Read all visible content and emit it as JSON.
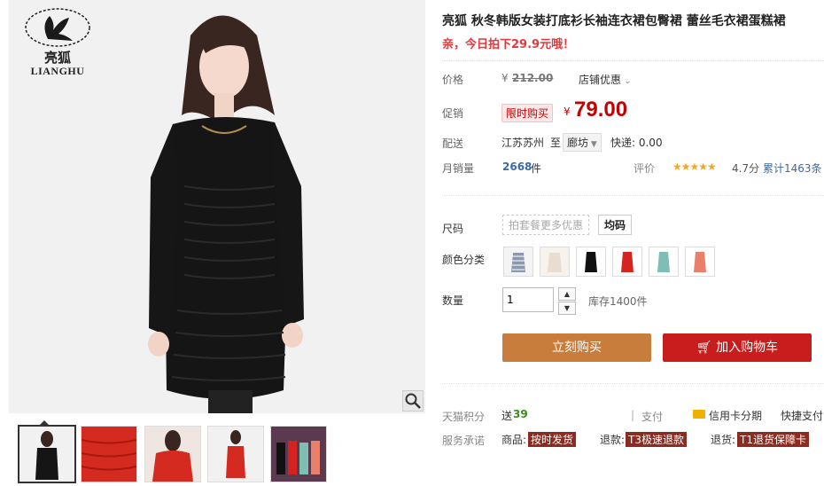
{
  "brand": {
    "logo_cn": "亮狐",
    "logo_en": "LIANGHU"
  },
  "product": {
    "title": "亮狐 秋冬韩版女装打底衫长袖连衣裙包臀裙 蕾丝毛衣裙蛋糕裙",
    "promo": "亲，今日拍下29.9元哦！"
  },
  "price": {
    "label": "价格",
    "currency": "¥",
    "original": "212.00",
    "discount_dropdown": "店铺优惠",
    "promo_label": "促销",
    "promo_tag": "限时购买",
    "promo_currency": "¥",
    "promo_price": "79.00"
  },
  "shipping": {
    "label": "配送",
    "from": "江苏苏州",
    "to_word": "至",
    "to_city": "廊坊",
    "express": "快递: 0.00"
  },
  "sales": {
    "label": "月销量",
    "count": "2668",
    "unit": "件",
    "rating_label": "评价",
    "stars": "★★★★★",
    "score": "4.7分",
    "reviews": "累计1463条"
  },
  "options": {
    "size_label": "尺码",
    "size_hint": "拍套餐更多优惠",
    "size_value": "均码",
    "color_label": "颜色分类",
    "colors": [
      "#f0f0f0",
      "#efe8e0",
      "#111111",
      "#d7231f",
      "#7dbfb4",
      "#e8806c"
    ]
  },
  "quantity": {
    "label": "数量",
    "value": "1",
    "stock": "库存1400件"
  },
  "buttons": {
    "buy": "立刻购买",
    "cart": "加入购物车"
  },
  "footer": {
    "points_label": "天猫积分",
    "points_prefix": "送",
    "points_value": "39",
    "pay_label": "支付",
    "credit": "信用卡分期",
    "quick": "快捷支付",
    "service_label": "服务承诺",
    "s1_label": "商品:",
    "s1_badge": "按时发货",
    "s2_label": "退款:",
    "s2_badge": "T3极速退款",
    "s3_label": "退货:",
    "s3_badge": "T1退货保障卡"
  }
}
